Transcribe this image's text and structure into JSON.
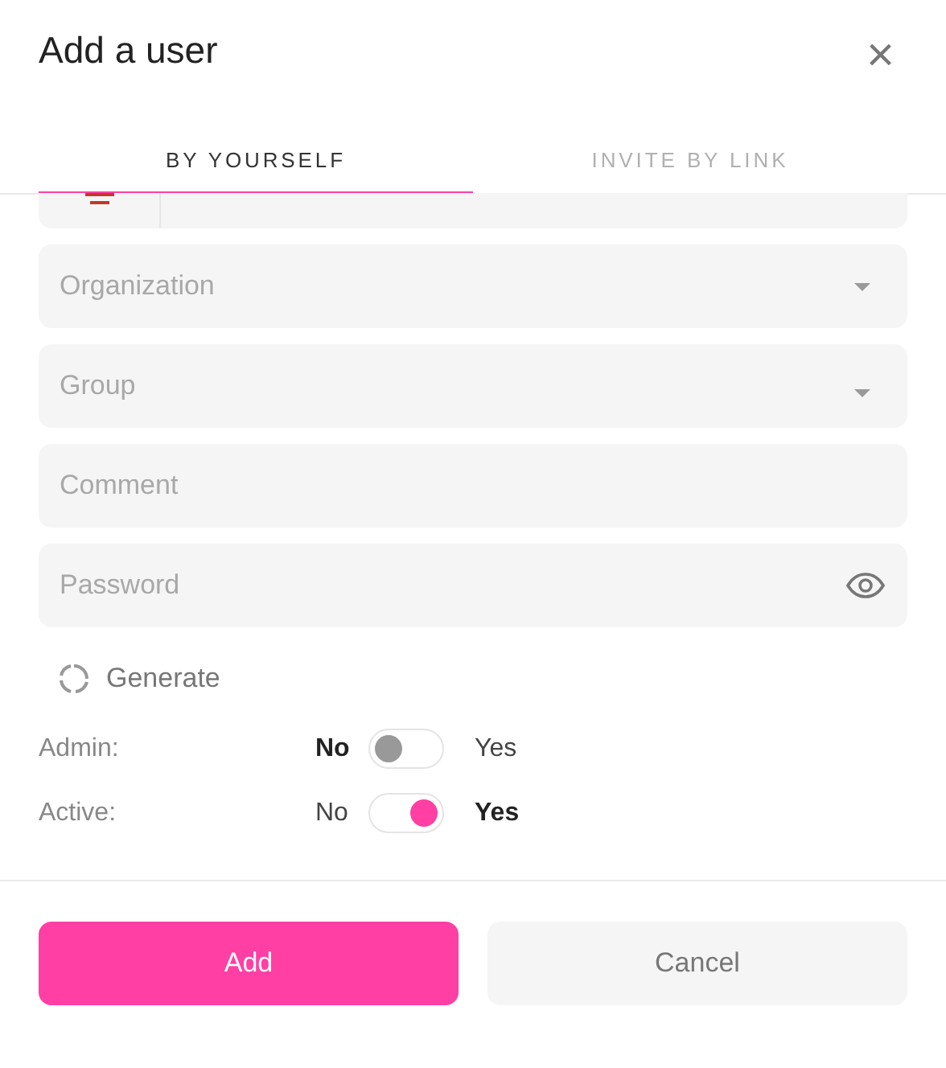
{
  "dialog": {
    "title": "Add a user",
    "close": "×"
  },
  "tabs": [
    {
      "label": "BY YOURSELF",
      "selected": true
    },
    {
      "label": "INVITE BY LINK",
      "selected": false
    }
  ],
  "fields": [
    {
      "kind": "phone"
    },
    {
      "kind": "select",
      "placeholder": "Organization"
    },
    {
      "kind": "select",
      "placeholder": "Group"
    },
    {
      "kind": "text",
      "placeholder": "Comment"
    },
    {
      "kind": "password",
      "placeholder": "Password"
    }
  ],
  "generate": "Generate",
  "toggles": [
    {
      "label": "Admin:",
      "no": "No",
      "yes": "Yes",
      "on": false
    },
    {
      "label": "Active:",
      "no": "No",
      "yes": "Yes",
      "on": true
    }
  ],
  "buttons": [
    {
      "label": "Add",
      "kind": "primary"
    },
    {
      "label": "Cancel",
      "kind": "secondary"
    }
  ]
}
